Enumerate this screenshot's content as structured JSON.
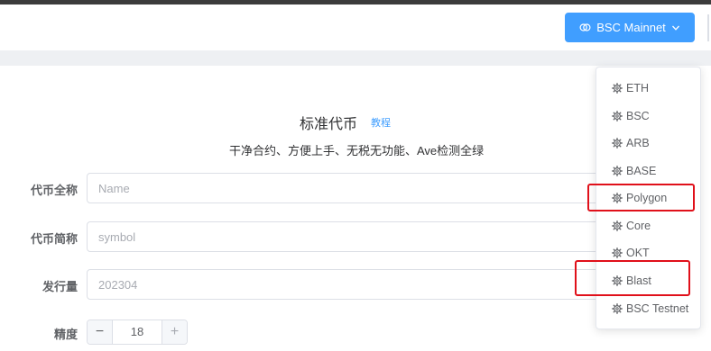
{
  "header": {
    "network_button": {
      "label": "BSC Mainnet",
      "icon": "network-icon"
    }
  },
  "page": {
    "title": "标准代币",
    "tutorial_link": "教程",
    "subtitle": "干净合约、方便上手、无税无功能、Ave检测全绿"
  },
  "form": {
    "name": {
      "label": "代币全称",
      "placeholder": "Name",
      "value": ""
    },
    "symbol": {
      "label": "代币简称",
      "placeholder": "symbol",
      "value": ""
    },
    "supply": {
      "label": "发行量",
      "placeholder": "202304",
      "value": ""
    },
    "decimals": {
      "label": "精度",
      "value": "18",
      "decrement": "−",
      "increment": "+"
    }
  },
  "network_dropdown": {
    "items": [
      {
        "label": "ETH"
      },
      {
        "label": "BSC"
      },
      {
        "label": "ARB"
      },
      {
        "label": "BASE"
      },
      {
        "label": "Polygon"
      },
      {
        "label": "Core"
      },
      {
        "label": "OKT"
      },
      {
        "label": "Blast"
      },
      {
        "label": "BSC Testnet"
      }
    ],
    "highlighted": [
      "Polygon",
      "Blast"
    ]
  },
  "colors": {
    "primary": "#409eff",
    "highlight": "#e0101a"
  }
}
